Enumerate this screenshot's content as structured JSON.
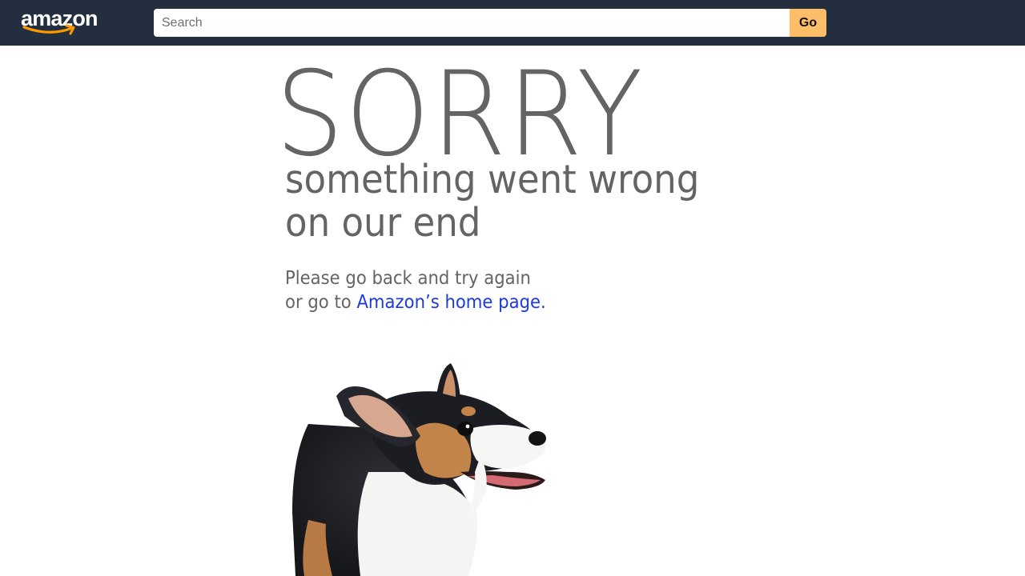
{
  "header": {
    "logo_text": "amazon",
    "search": {
      "placeholder": "Search",
      "value": ""
    },
    "go_label": "Go"
  },
  "main": {
    "heading": "SORRY",
    "subtitle_line1": "something went wrong",
    "subtitle_line2": "on our end",
    "message_line1": "Please go back and try again",
    "message_line2_prefix": "or go to",
    "home_link": "Amazon’s home page.",
    "dog_image": "dog-image"
  },
  "colors": {
    "navbar_bg": "#232f3e",
    "go_button_bg": "#febd69",
    "logo_smile": "#ff9900",
    "text_gray": "#646464",
    "link_blue": "#1c3ae2"
  }
}
